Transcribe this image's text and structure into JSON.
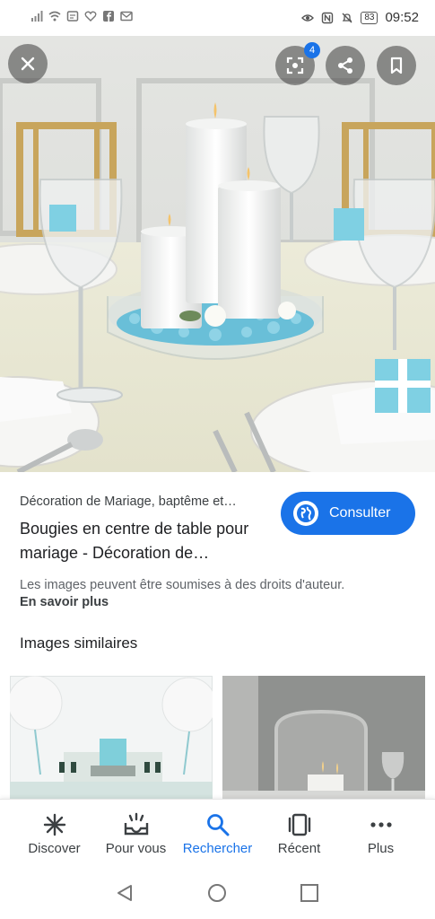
{
  "status_bar": {
    "time": "09:52",
    "battery": "83",
    "left_icons": [
      "signal-icon",
      "wifi-icon",
      "notification-icon",
      "heart-icon",
      "facebook-icon",
      "gmail-icon"
    ],
    "right_icons": [
      "eye-icon",
      "nfc-icon",
      "mute-icon"
    ]
  },
  "viewer": {
    "badge_count": "4",
    "close_icon": "close-icon",
    "lens_icon": "lens-icon",
    "share_icon": "share-icon",
    "bookmark_icon": "bookmark-icon"
  },
  "result": {
    "source": "Décoration de Mariage, baptême et…",
    "title": "Bougies en centre de table pour mariage - Décoration de…",
    "consult_label": "Consulter",
    "rights_text": "Les images peuvent être soumises à des droits d'auteur.",
    "learn_more": "En savoir plus"
  },
  "similar": {
    "heading": "Images similaires"
  },
  "bottom_nav": {
    "items": [
      {
        "label": "Discover",
        "icon": "asterisk-icon"
      },
      {
        "label": "Pour vous",
        "icon": "inbox-icon"
      },
      {
        "label": "Rechercher",
        "icon": "search-icon",
        "active": true
      },
      {
        "label": "Récent",
        "icon": "tabs-icon"
      },
      {
        "label": "Plus",
        "icon": "more-icon"
      }
    ]
  },
  "colors": {
    "accent": "#1a73e8",
    "text": "#202124",
    "muted": "#5f6368"
  }
}
